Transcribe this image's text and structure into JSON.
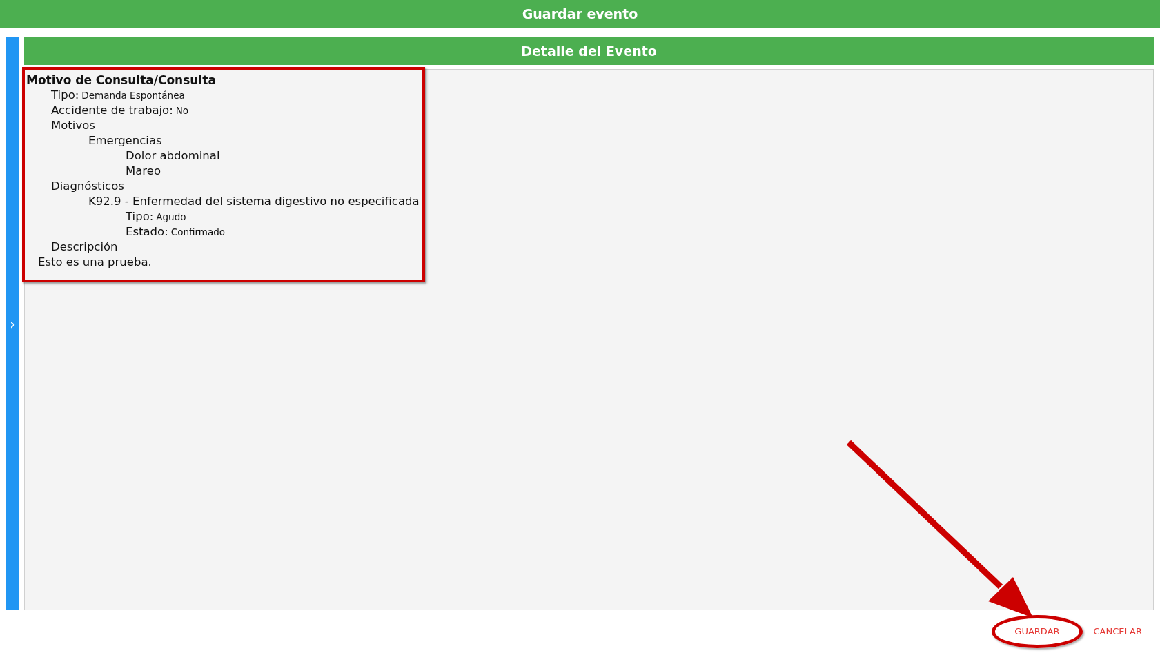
{
  "window": {
    "title": "Guardar evento"
  },
  "sidebar_toggle": {
    "icon": "›"
  },
  "detail": {
    "header": "Detalle del Evento",
    "section_title": "Motivo de Consulta/Consulta",
    "items": [
      {
        "label": "Tipo:",
        "value": "Demanda Espontánea"
      },
      {
        "label": "Accidente de trabajo:",
        "value": "No"
      },
      {
        "label": "Motivos",
        "children": [
          {
            "label": "Emergencias",
            "children": [
              {
                "label": "Dolor abdominal"
              },
              {
                "label": "Mareo"
              }
            ]
          }
        ]
      },
      {
        "label": "Diagnósticos",
        "children": [
          {
            "label": "K92.9 - Enfermedad del sistema digestivo no especificada",
            "children": [
              {
                "label": "Tipo:",
                "value": "Agudo"
              },
              {
                "label": "Estado:",
                "value": "Confirmado"
              }
            ]
          }
        ]
      },
      {
        "label": "Descripción"
      }
    ],
    "description": "Esto es una prueba."
  },
  "buttons": [
    {
      "label": "GUARDAR",
      "highlighted": true
    },
    {
      "label": "CANCELAR",
      "highlighted": false
    }
  ]
}
